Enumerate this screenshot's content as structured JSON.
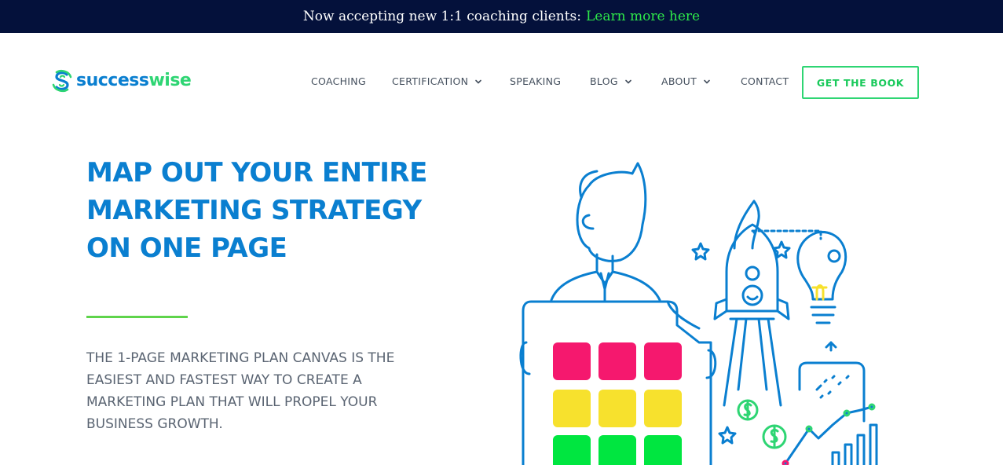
{
  "announcement": {
    "text": "Now accepting new 1:1 coaching clients:",
    "link_label": "Learn more here"
  },
  "brand": {
    "name_part1": "success",
    "name_part2": "wise",
    "logo_icon": "successwise-logo-icon"
  },
  "nav": {
    "items": [
      {
        "label": "COACHING",
        "has_dropdown": false
      },
      {
        "label": "CERTIFICATION",
        "has_dropdown": true
      },
      {
        "label": "SPEAKING",
        "has_dropdown": false
      },
      {
        "label": "BLOG",
        "has_dropdown": true
      },
      {
        "label": "ABOUT",
        "has_dropdown": true
      },
      {
        "label": "CONTACT",
        "has_dropdown": false
      }
    ],
    "cta_label": "GET THE BOOK"
  },
  "hero": {
    "title_lines": [
      "MAP OUT YOUR ENTIRE",
      "MARKETING STRATEGY",
      "ON ONE PAGE"
    ],
    "subtitle_lines": [
      "THE 1-PAGE MARKETING PLAN CANVAS IS THE",
      "EASIEST AND FASTEST WAY TO CREATE A",
      "MARKETING PLAN THAT WILL PROPEL YOUR",
      "BUSINESS GROWTH."
    ]
  },
  "colors": {
    "topbar_bg": "#04113b",
    "brand_blue": "#0a7fd0",
    "brand_green": "#2ed573",
    "accent_pink": "#f5186e",
    "accent_yellow": "#f7e12d",
    "accent_green": "#00e640",
    "text_gray": "#5a6472"
  },
  "illustration": {
    "icons": [
      "person-holding-canvas-icon",
      "rocket-icon",
      "lightbulb-icon",
      "star-icon",
      "dollar-coin-icon",
      "growth-chart-icon"
    ]
  }
}
